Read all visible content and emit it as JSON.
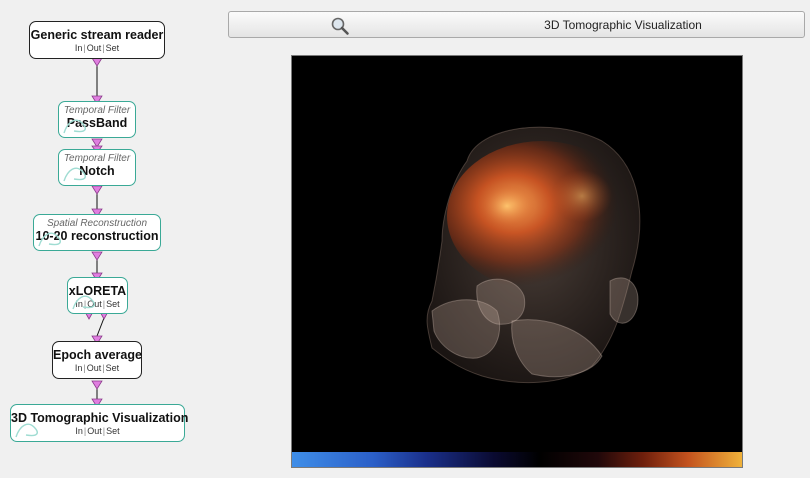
{
  "pipeline": {
    "nodes": [
      {
        "id": "generic-stream-reader",
        "category": "",
        "title": "Generic stream reader",
        "io": [
          "In",
          "Out",
          "Set"
        ]
      },
      {
        "id": "temporal-filter-passband",
        "category": "Temporal Filter",
        "title": "PassBand",
        "io": []
      },
      {
        "id": "temporal-filter-notch",
        "category": "Temporal Filter",
        "title": "Notch",
        "io": []
      },
      {
        "id": "spatial-reconstruction",
        "category": "Spatial Reconstruction",
        "title": "10-20 reconstruction",
        "io": []
      },
      {
        "id": "xloreta",
        "category": "",
        "title": "xLORETA",
        "io": [
          "In",
          "Out",
          "Set"
        ]
      },
      {
        "id": "epoch-average",
        "category": "",
        "title": "Epoch average",
        "io": [
          "In",
          "Out",
          "Set"
        ]
      },
      {
        "id": "3d-tomographic-visualization",
        "category": "",
        "title": "3D Tomographic Visualization",
        "io": [
          "In",
          "Out",
          "Set"
        ]
      }
    ]
  },
  "visualization": {
    "title": "3D Tomographic Visualization",
    "search_icon": "magnifier-icon"
  },
  "colors": {
    "node_border_teal": "#3aa996",
    "port_pink": "#e07ee0",
    "viewport_bg": "#000000"
  }
}
